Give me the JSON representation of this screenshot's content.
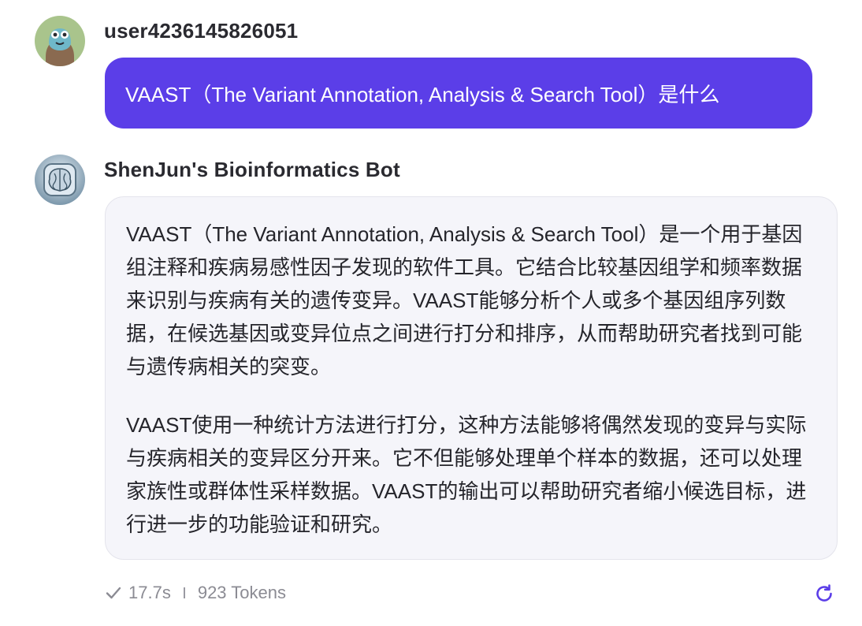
{
  "user_message": {
    "username": "user4236145826051",
    "text": "VAAST（The Variant Annotation, Analysis & Search Tool）是什么"
  },
  "bot_message": {
    "name": "ShenJun's Bioinformatics Bot",
    "paragraphs": [
      "VAAST（The Variant Annotation, Analysis & Search Tool）是一个用于基因组注释和疾病易感性因子发现的软件工具。它结合比较基因组学和频率数据来识别与疾病有关的遗传变异。VAAST能够分析个人或多个基因组序列数据，在候选基因或变异位点之间进行打分和排序，从而帮助研究者找到可能与遗传病相关的突变。",
      "VAAST使用一种统计方法进行打分，这种方法能够将偶然发现的变异与实际与疾病相关的变异区分开来。它不但能够处理单个样本的数据，还可以处理家族性或群体性采样数据。VAAST的输出可以帮助研究者缩小候选目标，进行进一步的功能验证和研究。"
    ],
    "time": "17.7s",
    "tokens": "923 Tokens"
  },
  "icons": {
    "status": "check-icon",
    "action": "regenerate-icon"
  },
  "colors": {
    "accent": "#5b3ee8",
    "bot_bubble_bg": "#f5f5fa",
    "meta_text": "#8b8b93"
  }
}
